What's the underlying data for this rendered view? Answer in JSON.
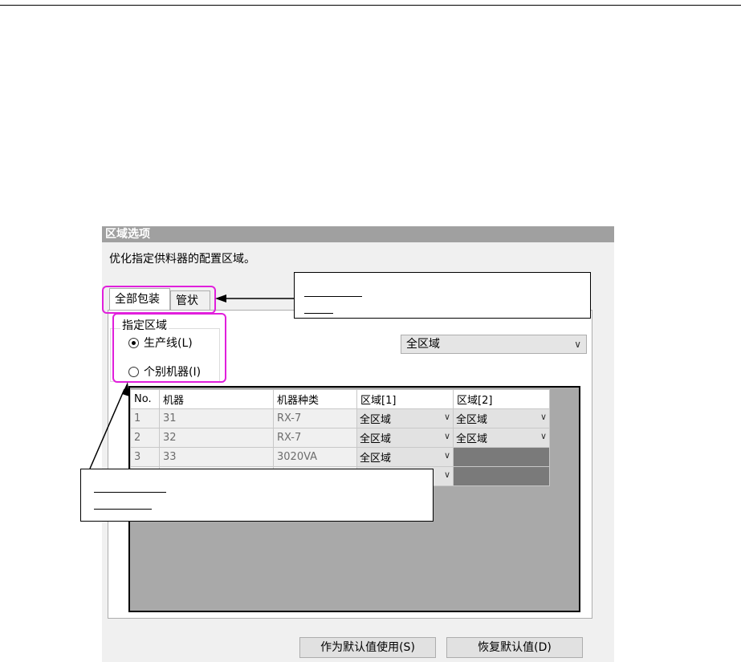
{
  "dialog": {
    "title": "区域选项",
    "description": "优化指定供料器的配置区域。",
    "tabs": [
      {
        "label": "全部包装"
      },
      {
        "label": "管状"
      }
    ],
    "group": {
      "title": "指定区域",
      "options": [
        {
          "label": "生产线(L)",
          "selected": true
        },
        {
          "label": "个别机器(I)",
          "selected": false
        }
      ]
    },
    "area_dropdown": {
      "value": "全区域"
    },
    "table": {
      "headers": [
        "No.",
        "机器",
        "机器种类",
        "区域[1]",
        "区域[2]"
      ],
      "rows": [
        {
          "no": "1",
          "machine": "31",
          "type": "RX-7",
          "area1": "全区域",
          "area2": "全区域"
        },
        {
          "no": "2",
          "machine": "32",
          "type": "RX-7",
          "area1": "全区域",
          "area2": "全区域"
        },
        {
          "no": "3",
          "machine": "33",
          "type": "3020VA",
          "area1": "全区域",
          "area2": ""
        },
        {
          "no": "",
          "machine": "",
          "type": "",
          "area1": "",
          "area2": ""
        }
      ]
    },
    "buttons": {
      "set_default": "作为默认值使用(S)",
      "restore_default": "恢复默认值(D)"
    }
  },
  "colors": {
    "highlight": "#e11fdc",
    "titlebar": "#a0a0a0"
  }
}
